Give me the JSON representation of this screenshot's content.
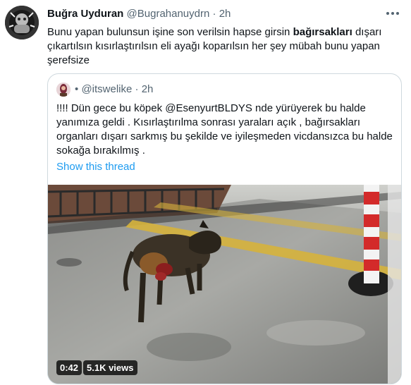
{
  "author": {
    "name": "Buğra Uyduran",
    "handle": "@Bugrahanuydrn",
    "separator": "·",
    "time": "2h",
    "avatar_icon": "avatar-icon"
  },
  "tweet": {
    "text_before": "Bunu yapan bulunsun işine son verilsin hapse girsin ",
    "text_bold": "bağırsakları",
    "text_after": " dışarı çıkartılsın kısırlaştırılsın eli ayağı koparılsın her şey mübah bunu yapan şerefsize"
  },
  "more_icon": "more-horizontal-icon",
  "quote": {
    "separator": "•",
    "handle": "@itswelike",
    "dot": "·",
    "time": "2h",
    "lines": [
      "!!!! Dün gece bu köpek @EsenyurtBLDYS nde yürüyerek bu halde",
      "yanımıza geldi .   Kısırlaştırılma sonrası yaraları açık , bağırsakları",
      "organları dışarı sarkmış bu şekilde ve iyileşmeden vicdansızca bu halde",
      "sokağa bırakılmış ."
    ],
    "show_thread": "Show this thread",
    "video": {
      "duration": "0:42",
      "views": "5.1K views"
    }
  },
  "colors": {
    "link": "#1d9bf0",
    "secondary_text": "#536471",
    "border": "#cfd9de",
    "yellow_line": "#d6b23c",
    "pole_red": "#d32a2a"
  }
}
